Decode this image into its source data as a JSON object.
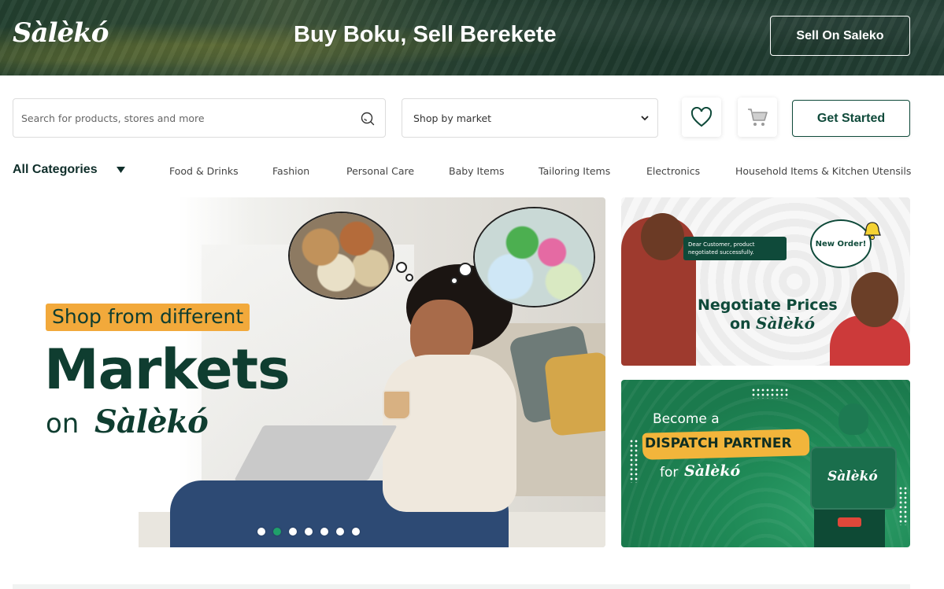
{
  "header": {
    "logo_text": "Sàlèkó",
    "tagline": "Buy Boku, Sell Berekete",
    "sell_button": "Sell On Saleko"
  },
  "search": {
    "placeholder": "Search for products, stores and more",
    "value": ""
  },
  "market_select": {
    "selected": "Shop by market"
  },
  "actions": {
    "get_started": "Get Started"
  },
  "categories": {
    "all_label": "All Categories",
    "items": [
      "Food & Drinks",
      "Fashion",
      "Personal Care",
      "Baby Items",
      "Tailoring Items",
      "Electronics",
      "Household Items & Kitchen Utensils"
    ]
  },
  "hero": {
    "pill": "Shop from different",
    "headline": "Markets",
    "on": "on",
    "logo_text": "Sàlèkó",
    "slide_count": 7,
    "active_slide": 2
  },
  "promo_negotiate": {
    "note": "Dear Customer, product negotiated successfully.",
    "new_order": "New Order!",
    "line1": "Negotiate Prices",
    "line2": "on",
    "logo_text": "Sàlèkó"
  },
  "promo_dispatch": {
    "become": "Become a",
    "highlight": "DISPATCH PARTNER",
    "for": "for",
    "logo_text": "Sàlèkó",
    "box_logo": "Sàlèkó"
  },
  "colors": {
    "brand_green": "#0f4a3a",
    "accent_orange": "#f2a93b",
    "active_dot": "#1fa06a"
  }
}
